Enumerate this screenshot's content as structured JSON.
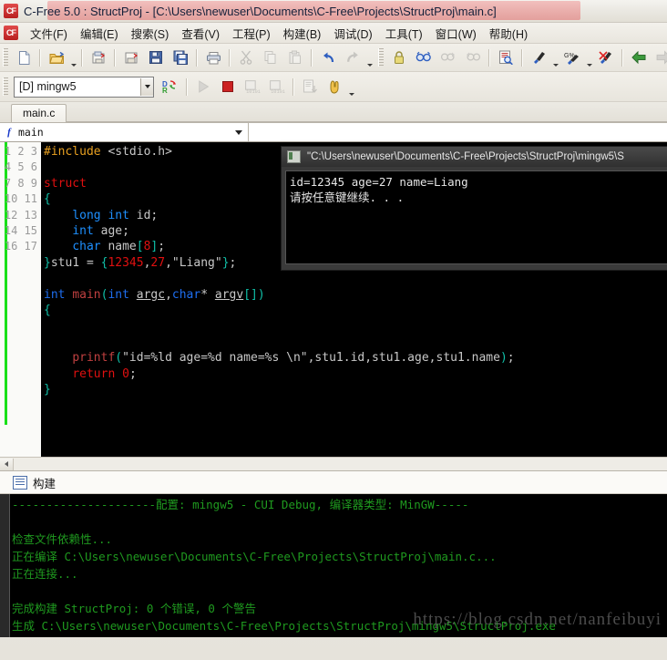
{
  "window": {
    "title": "C-Free 5.0 : StructProj - [C:\\Users\\newuser\\Documents\\C-Free\\Projects\\StructProj\\main.c]",
    "app_badge": "CF"
  },
  "menubar": {
    "items": [
      {
        "label": "文件(F)",
        "name": "menu-file"
      },
      {
        "label": "编辑(E)",
        "name": "menu-edit"
      },
      {
        "label": "搜索(S)",
        "name": "menu-search"
      },
      {
        "label": "查看(V)",
        "name": "menu-view"
      },
      {
        "label": "工程(P)",
        "name": "menu-project"
      },
      {
        "label": "构建(B)",
        "name": "menu-build"
      },
      {
        "label": "调试(D)",
        "name": "menu-debug"
      },
      {
        "label": "工具(T)",
        "name": "menu-tools"
      },
      {
        "label": "窗口(W)",
        "name": "menu-window"
      },
      {
        "label": "帮助(H)",
        "name": "menu-help"
      }
    ]
  },
  "toolbar_main": {
    "icons": [
      "new-file-icon",
      "open-folder-icon",
      "open-dropdown-arrow",
      "open-project-icon",
      "save-project-icon",
      "save-icon",
      "save-all-icon",
      "print-icon",
      "cut-icon",
      "copy-icon",
      "paste-icon",
      "undo-icon",
      "redo-icon",
      "undo-dropdown-arrow",
      "lock-icon",
      "find-icon",
      "find-next-icon",
      "find-prev-icon",
      "find-in-files-icon",
      "compile-icon",
      "compile-dropdown-arrow",
      "build-icon",
      "build-dropdown-arrow",
      "clean-icon",
      "back-icon",
      "forward-icon",
      "nav-dropdown-arrow",
      "bookmark-toggle-icon",
      "bookmark-next-icon",
      "bookmark-clear-icon",
      "bookmark-dropdown-arrow"
    ]
  },
  "toolbar_build": {
    "config_combo": {
      "value": "[D] mingw5",
      "name": "build-configuration-combo"
    },
    "icons": [
      "build-and-run-icon",
      "run-icon",
      "stop-icon",
      "step-over-icon",
      "step-into-icon",
      "go-to-line-icon",
      "pause-icon",
      "debug-dropdown-arrow"
    ]
  },
  "tabs": {
    "open_files": [
      {
        "label": "main.c",
        "active": true
      }
    ]
  },
  "function_selector": {
    "icon": "function-icon",
    "value": "main"
  },
  "editor": {
    "line_numbers": [
      "1",
      "2",
      "3",
      "4",
      "5",
      "6",
      "7",
      "8",
      "9",
      "10",
      "11",
      "12",
      "13",
      "14",
      "15",
      "16",
      "17"
    ],
    "lines": [
      "#include <stdio.h>",
      "",
      "struct",
      "{",
      "    long int id;",
      "    int age;",
      "    char name[8];",
      "}stu1 = {12345,27,\"Liang\"};",
      "",
      "int main(int argc,char* argv[])",
      "{",
      "",
      "",
      "    printf(\"id=%ld age=%d name=%s \\n\",stu1.id,stu1.age,stu1.name);",
      "    return 0;",
      "}",
      ""
    ]
  },
  "console_window": {
    "title": "\"C:\\Users\\newuser\\Documents\\C-Free\\Projects\\StructProj\\mingw5\\S",
    "icon": "console-icon",
    "output": "id=12345 age=27 name=Liang\n请按任意键继续. . ."
  },
  "build_panel": {
    "header_label": "构建",
    "header_icon": "build-output-icon",
    "output_lines": [
      "---------------------配置: mingw5 - CUI Debug, 编译器类型: MinGW-----",
      "",
      "检查文件依赖性...",
      "正在编译 C:\\Users\\newuser\\Documents\\C-Free\\Projects\\StructProj\\main.c...",
      "正在连接...",
      "",
      "完成构建 StructProj: 0 个错误, 0 个警告",
      "生成 C:\\Users\\newuser\\Documents\\C-Free\\Projects\\StructProj\\mingw5\\StructProj.exe"
    ]
  },
  "watermark": {
    "text": "https://blog.csdn.net/nanfeibuyi"
  },
  "colors": {
    "title_highlight": "#e47878",
    "build_output_green": "#1f9a1f",
    "change_bar_green": "#19e019",
    "keyword_blue": "#1e90ff",
    "keyword_red": "#e01010",
    "brace_teal": "#10c0a8",
    "preproc_orange": "#e8a020"
  }
}
